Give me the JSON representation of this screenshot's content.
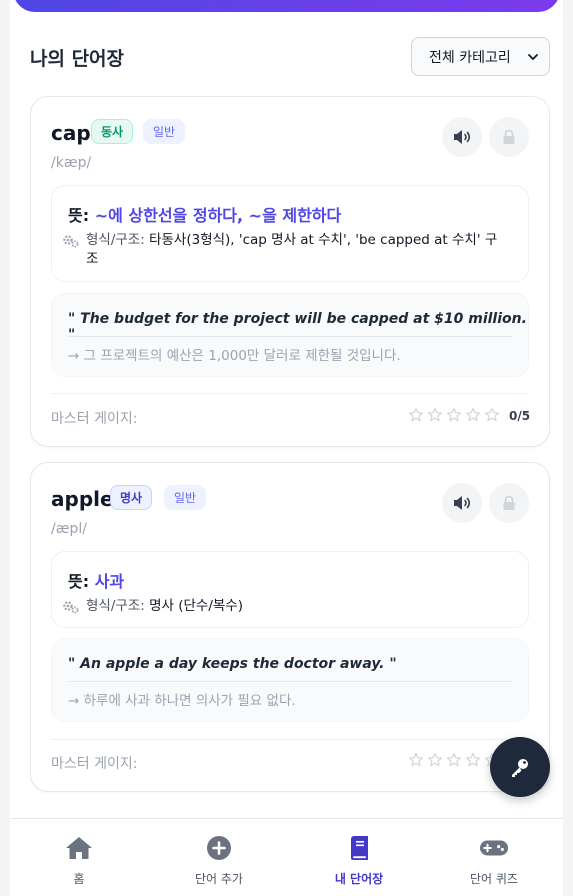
{
  "header": {
    "title": "나의 단어장",
    "category_select": {
      "selected": "전체 카테고리",
      "icon": "chevron-down-icon"
    }
  },
  "words": [
    {
      "word": "cap",
      "part_of_speech": "동사",
      "level": "일반",
      "phonetic": "/kæp/",
      "meaning_label": "뜻:",
      "meaning": "~에 상한선을 정하다, ~을 제한하다",
      "form_label": "형식/구조:",
      "form_line1": "타동사(3형식), 'cap 명사 at 수치', 'be capped at 수치' 구",
      "form_line2": "조",
      "example_en": "\" The budget for the project will be capped at $10 million. \"",
      "example_ko": "→ 그 프로젝트의 예산은 1,000만 달러로 제한될 것입니다.",
      "mastery_label": "마스터 게이지:",
      "mastery_stars": 0,
      "mastery_max": 5,
      "mastery_count": "0/5"
    },
    {
      "word": "apple",
      "part_of_speech": "명사",
      "level": "일반",
      "phonetic": "/æpl/",
      "meaning_label": "뜻:",
      "meaning": "사과",
      "form_label": "형식/구조:",
      "form_line1": "명사 (단수/복수)",
      "example_en": "\" An apple a day keeps the doctor away. \"",
      "example_ko": "→ 하루에 사과 하나면 의사가 필요 없다.",
      "mastery_label": "마스터 게이지:",
      "mastery_stars": 0,
      "mastery_max": 5
    }
  ],
  "fab": {
    "icon": "key-icon"
  },
  "nav": [
    {
      "label": "홈",
      "icon": "home-icon"
    },
    {
      "label": "단어 추가",
      "icon": "plus-circle-icon"
    },
    {
      "label": "내 단어장",
      "icon": "book-icon",
      "active": true
    },
    {
      "label": "단어 퀴즈",
      "icon": "gamepad-icon"
    }
  ],
  "colors": {
    "accent": "#4f46e5",
    "banner_gradient_start": "#4f46e5",
    "banner_gradient_end": "#7c3aed",
    "verb_badge": "#059669",
    "noun_badge": "#4338ca",
    "fab": "#1e293b"
  }
}
